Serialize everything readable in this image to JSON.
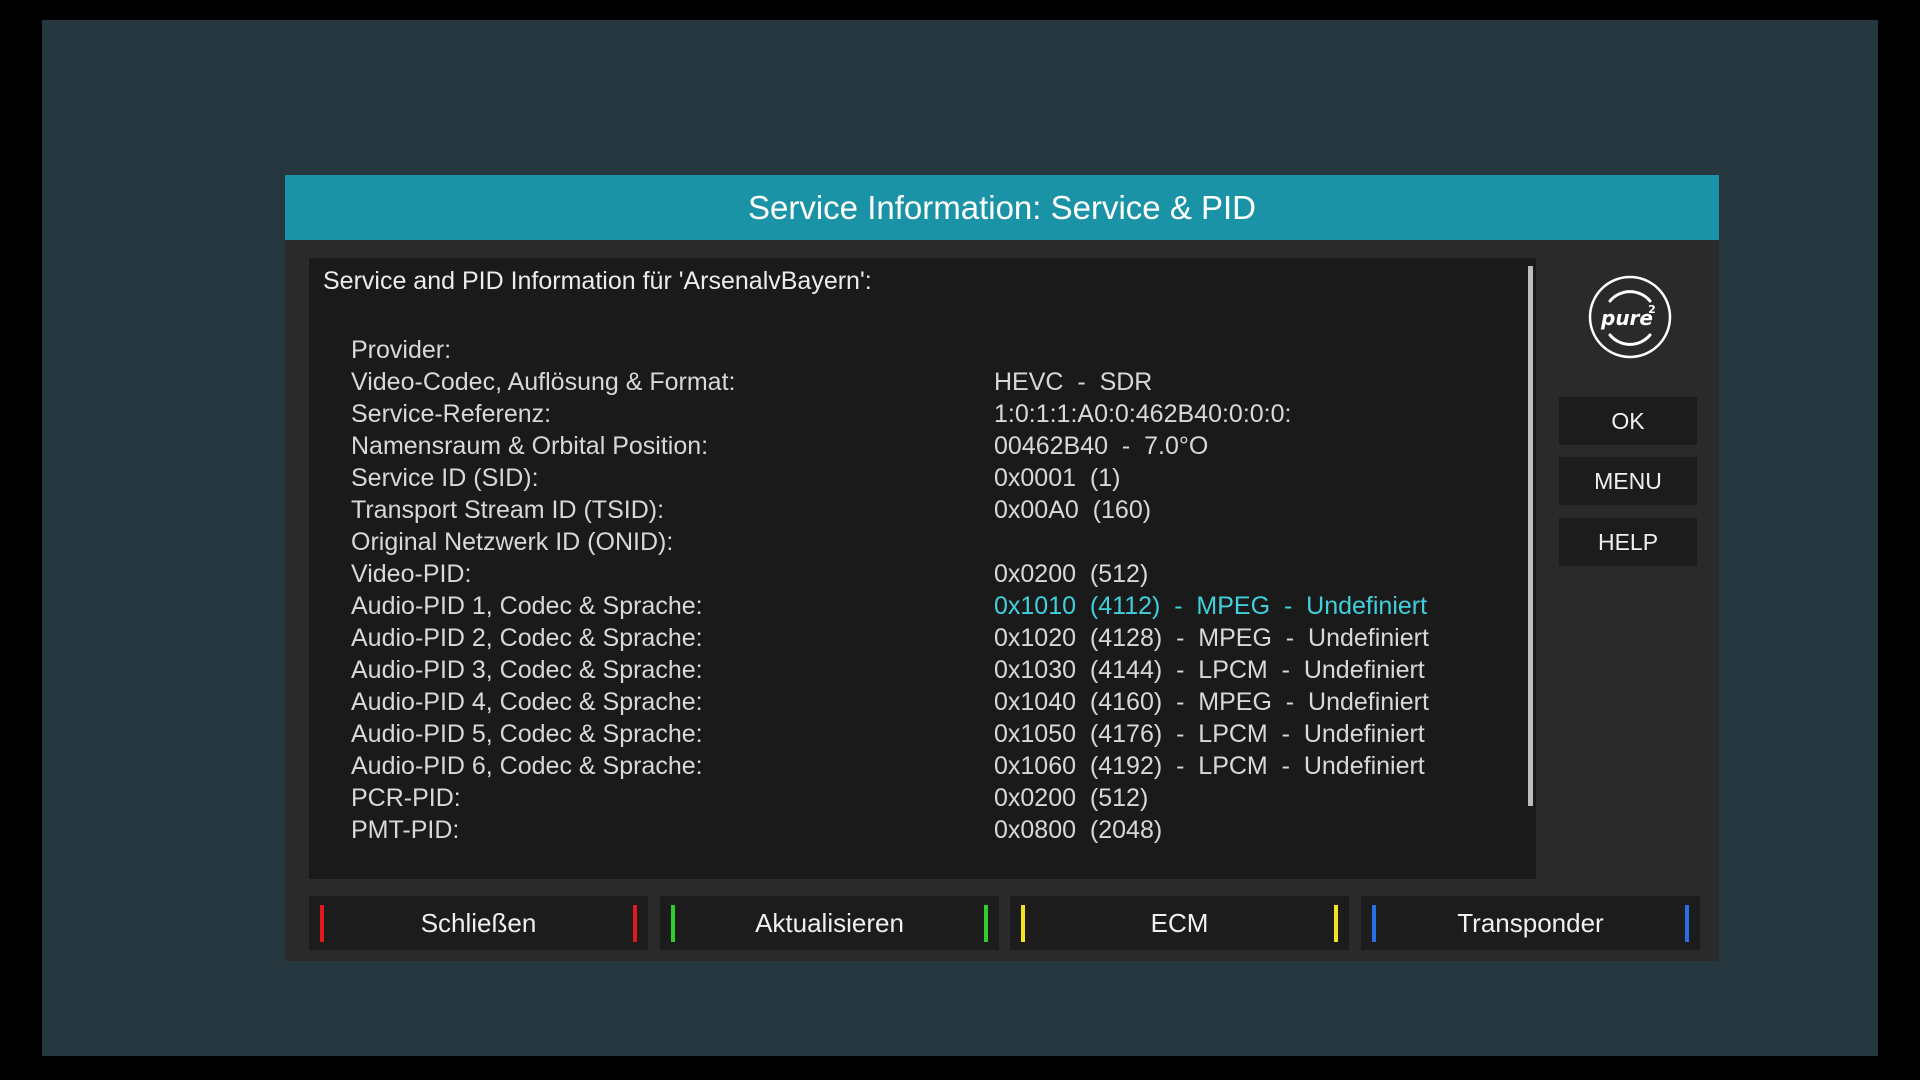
{
  "title": "Service Information: Service & PID",
  "heading": "Service and PID Information für 'ArsenalvBayern':",
  "rows": [
    {
      "label": "Provider:",
      "value": ""
    },
    {
      "label": "Video-Codec, Auflösung & Format:",
      "value": "HEVC  -  SDR"
    },
    {
      "label": "Service-Referenz:",
      "value": "1:0:1:1:A0:0:462B40:0:0:0:"
    },
    {
      "label": "Namensraum & Orbital Position:",
      "value": "00462B40  -  7.0°O"
    },
    {
      "label": "Service ID (SID):",
      "value": "0x0001  (1)"
    },
    {
      "label": "Transport Stream ID (TSID):",
      "value": "0x00A0  (160)"
    },
    {
      "label": "Original Netzwerk ID (ONID):",
      "value": ""
    },
    {
      "label": "Video-PID:",
      "value": "0x0200  (512)"
    },
    {
      "label": "Audio-PID 1, Codec & Sprache:",
      "value": "0x1010  (4112)  -  MPEG  -  Undefiniert",
      "selected": true
    },
    {
      "label": "Audio-PID 2, Codec & Sprache:",
      "value": "0x1020  (4128)  -  MPEG  -  Undefiniert"
    },
    {
      "label": "Audio-PID 3, Codec & Sprache:",
      "value": "0x1030  (4144)  -  LPCM  -  Undefiniert"
    },
    {
      "label": "Audio-PID 4, Codec & Sprache:",
      "value": "0x1040  (4160)  -  MPEG  -  Undefiniert"
    },
    {
      "label": "Audio-PID 5, Codec & Sprache:",
      "value": "0x1050  (4176)  -  LPCM  -  Undefiniert"
    },
    {
      "label": "Audio-PID 6, Codec & Sprache:",
      "value": "0x1060  (4192)  -  LPCM  -  Undefiniert"
    },
    {
      "label": "PCR-PID:",
      "value": "0x0200  (512)"
    },
    {
      "label": "PMT-PID:",
      "value": "0x0800  (2048)"
    }
  ],
  "logo": {
    "text": "pure",
    "superscript": "2",
    "icon": "pure2-logo-icon"
  },
  "side_buttons": {
    "ok": "OK",
    "menu": "MENU",
    "help": "HELP"
  },
  "color_buttons": [
    {
      "label": "Schließen",
      "color": "#e0191e"
    },
    {
      "label": "Aktualisieren",
      "color": "#2fce2a"
    },
    {
      "label": "ECM",
      "color": "#f2e322"
    },
    {
      "label": "Transponder",
      "color": "#2a6ee6"
    }
  ],
  "colors": {
    "background": "#263740",
    "title_bar": "#1b93a6",
    "selected_text": "#3fd0dc"
  }
}
